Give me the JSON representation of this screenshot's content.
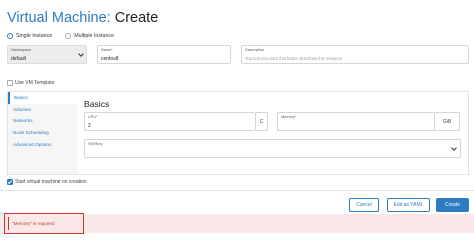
{
  "header": {
    "title_prefix": "Virtual Machine:",
    "title_suffix": "Create"
  },
  "instance_mode": {
    "options": [
      {
        "label": "Single Instance",
        "selected": true
      },
      {
        "label": "Multiple Instance",
        "selected": false
      }
    ]
  },
  "form": {
    "namespace": {
      "label": "Namespace",
      "value": "default"
    },
    "name": {
      "label": "Name",
      "required_mark": "*",
      "value": "centos8"
    },
    "description": {
      "label": "Description",
      "placeholder": "You text you want that better describes this resource"
    },
    "use_vm_template": {
      "label": "Use VM Template",
      "checked": false
    }
  },
  "basics_panel": {
    "nav_items": [
      {
        "label": "Basics",
        "active": true
      },
      {
        "label": "Volumes",
        "active": false
      },
      {
        "label": "Networks",
        "active": false
      },
      {
        "label": "Node Scheduling",
        "active": false
      },
      {
        "label": "Advanced Options",
        "active": false
      }
    ],
    "section_title": "Basics",
    "cpu": {
      "label": "CPU",
      "required_mark": "*",
      "value": "2",
      "unit": "C"
    },
    "memory": {
      "label": "Memory",
      "required_mark": "*",
      "value": "",
      "unit": "GiB"
    },
    "ssh_key": {
      "label": "SSHKey",
      "value": ""
    }
  },
  "start_on_creation": {
    "label": "Start virtual machine on creation",
    "checked": true
  },
  "actions": {
    "cancel": "Cancel",
    "edit_yaml": "Edit as YAML",
    "create": "Create"
  },
  "error": {
    "message": "\"Memory\" is required"
  },
  "colors": {
    "accent": "#2d7cc1",
    "error": "#d33333",
    "error_bg": "#fbe9ea"
  }
}
